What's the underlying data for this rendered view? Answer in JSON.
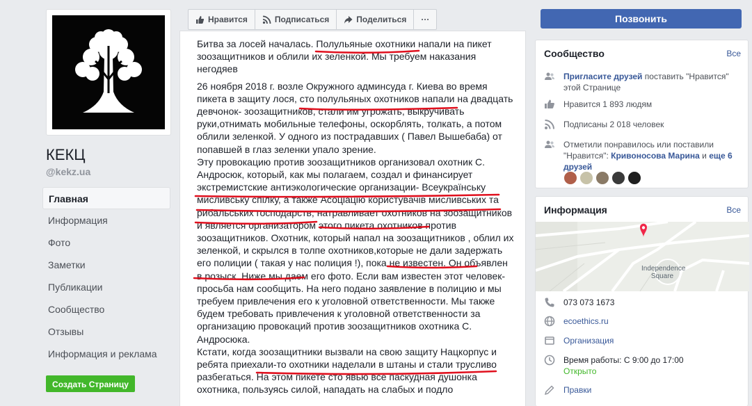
{
  "sidebar": {
    "page_name": "КЕКЦ",
    "handle": "@kekz.ua",
    "nav": [
      "Главная",
      "Информация",
      "Фото",
      "Заметки",
      "Публикации",
      "Сообщество",
      "Отзывы",
      "Информация и реклама"
    ],
    "create_page": "Создать Страницу"
  },
  "actions": {
    "like": "Нравится",
    "subscribe": "Подписаться",
    "share": "Поделиться",
    "more": "···"
  },
  "post": {
    "p1": "Битва за лосей началась. Полульяные охотники напали на пикет зоозащитников и облили их зеленкой. Мы требуем наказания негодяев",
    "p2": "26 ноября 2018 г. возле Окружного админсуда г. Киева во время пикета в защиту лося, сто полульяных охотников напали на двадцать девчонок- зоозащитников, стали им угрожать, выкручивать руки,отнимать мобильные телефоны, оскорблять, толкать, а потом облили зеленкой. У одного из пострадавших ( Павел Вышебаба) от попавшей в глаз зеленки упало зрение.",
    "p3": "Эту провокацию против зоозащитников организовал охотник С. Андросюк, который, как мы полагаем, создал и финансирует экстремистские антиэкологические организации- Всеукраїнську мисливську спілку, а также Асоціацію користувачів мисливських та рибальських господарств, натравливает охотников на зоозащитников и является организатором этого пикета охотников против зоозащитников. Охотник, который напал на зоозащитников , облил их зеленкой, и скрылся в толпе охотников,которые не дали задержать его полиции ( такая у нас полиция !), пока не известен. Он объявлен в розыск. Ниже мы даем его фото. Если вам известен этот человек-просьба нам сообщить. На него подано заявление в полицию и мы требуем привлечения его к уголовной ответственности. Мы также будем требовать привлечения к уголовной ответственности за организацию провокаций против зоозащитников охотника С. Андросюка.",
    "p4": "Кстати, когда зоозащитники вызвали на свою защиту Нацкорпус и ребята приехали-то охотники наделали в штаны и стали трусливо разбегаться. На этом пикете сто явью все паскудная душонка охотника, пользуясь силой, нападать на слабых и подло"
  },
  "call_button": "Позвонить",
  "community": {
    "title": "Сообщество",
    "see_all": "Все",
    "invite_link": "Пригласите друзей",
    "invite_rest": " поставить \"Нравится\" этой Странице",
    "likes": "Нравится 1 893 людям",
    "followers": "Подписаны 2 018 человек",
    "friends_pre": "Отметили понравилось или поставили \"Нравится\": ",
    "friends_name": "Кривоносова Марина",
    "friends_mid": " и ",
    "friends_more": "еще 6 друзей"
  },
  "info": {
    "title": "Информация",
    "see_all": "Все",
    "map_label": "Independence Square",
    "phone": "073 073 1673",
    "website": "ecoethics.ru",
    "category": "Организация",
    "hours": "Время работы: С 9:00 до 17:00",
    "open_status": "Открыто",
    "edits": "Правки"
  },
  "colors": {
    "primary": "#4267b2",
    "link": "#385898",
    "green": "#42b72a",
    "underline": "#e0101e",
    "map_pin": "#f02849"
  }
}
